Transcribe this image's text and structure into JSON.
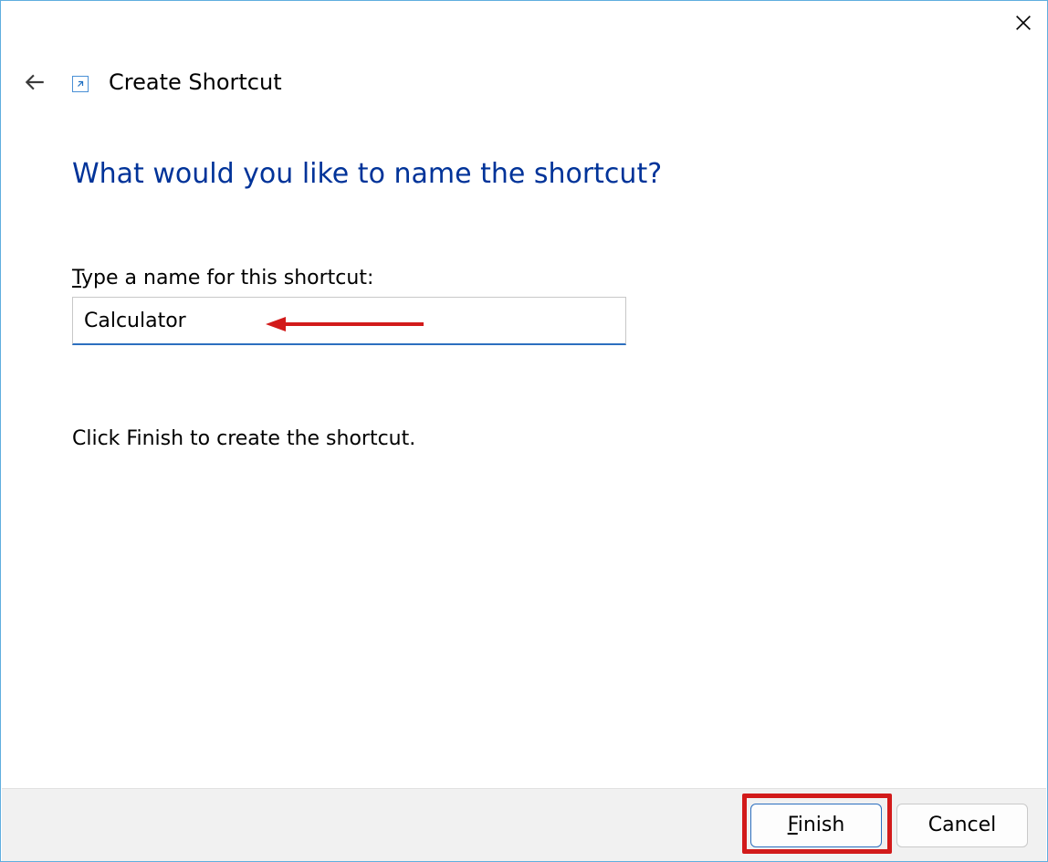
{
  "window": {
    "title": "Create Shortcut"
  },
  "content": {
    "heading": "What would you like to name the shortcut?",
    "field_label_prefix": "T",
    "field_label_rest": "ype a name for this shortcut:",
    "input_value": "Calculator",
    "instruction": "Click Finish to create the shortcut."
  },
  "footer": {
    "finish_prefix": "F",
    "finish_rest": "inish",
    "cancel": "Cancel"
  },
  "icons": {
    "close": "close-icon",
    "back": "back-arrow-icon",
    "shortcut_overlay": "shortcut-overlay-icon"
  },
  "annotation": {
    "arrow_color": "#d21a1a",
    "highlight_color": "#d21a1a"
  }
}
